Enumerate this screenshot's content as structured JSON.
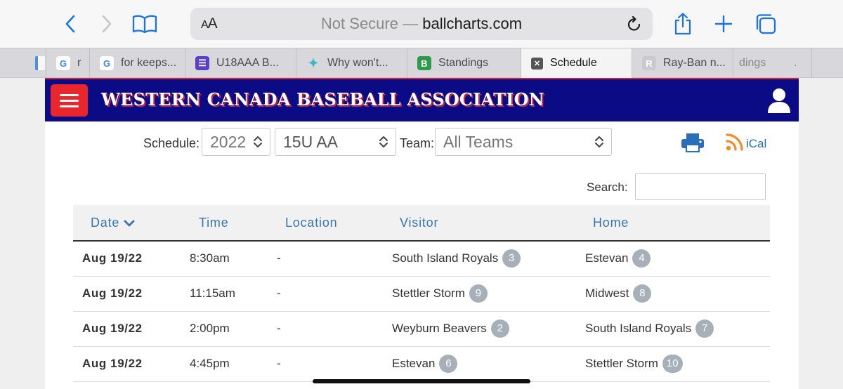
{
  "browser": {
    "address_aa": "AA",
    "not_secure": "Not Secure —",
    "domain": "ballcharts.com",
    "tabs": [
      {
        "label": "r",
        "favicon": "G",
        "fav_color": "#4285f4"
      },
      {
        "label": "for keeps...",
        "favicon": "G",
        "fav_color": "#4285f4"
      },
      {
        "label": "U18AAA B...",
        "favicon": "☰",
        "fav_color": "#5b3fc4"
      },
      {
        "label": "Why won't...",
        "favicon": "✦",
        "fav_color": "#3fb5c4"
      },
      {
        "label": "Standings",
        "favicon": "B",
        "fav_color": "#2e9a4b"
      },
      {
        "label": "Schedule",
        "favicon": "✕",
        "fav_color": "#555555"
      },
      {
        "label": "Ray-Ban n...",
        "favicon": "R",
        "fav_color": "#c9c9ce"
      },
      {
        "label": "dings",
        "favicon": "",
        "fav_color": ""
      },
      {
        "label": ".",
        "favicon": "",
        "fav_color": ""
      }
    ]
  },
  "site": {
    "title": "WESTERN CANADA BASEBALL ASSOCIATION"
  },
  "filters": {
    "schedule_label": "Schedule:",
    "year": "2022",
    "division": "15U AA",
    "team_label": "Team:",
    "team": "All Teams",
    "ical_label": "iCal",
    "search_label": "Search:",
    "search_value": ""
  },
  "table": {
    "headers": [
      "Date",
      "Time",
      "Location",
      "Visitor",
      "Home"
    ],
    "rows": [
      {
        "date": "Aug 19/22",
        "time": "8:30am",
        "location": "-",
        "visitor": "South Island Royals",
        "visitor_score": "3",
        "home": "Estevan",
        "home_score": "4"
      },
      {
        "date": "Aug 19/22",
        "time": "11:15am",
        "location": "-",
        "visitor": "Stettler Storm",
        "visitor_score": "9",
        "home": "Midwest",
        "home_score": "8"
      },
      {
        "date": "Aug 19/22",
        "time": "2:00pm",
        "location": "-",
        "visitor": "Weyburn Beavers",
        "visitor_score": "2",
        "home": "South Island Royals",
        "home_score": "7"
      },
      {
        "date": "Aug 19/22",
        "time": "4:45pm",
        "location": "-",
        "visitor": "Estevan",
        "visitor_score": "6",
        "home": "Stettler Storm",
        "home_score": "10"
      }
    ]
  },
  "colors": {
    "banner": "#0b0b86",
    "menu": "#e8262c",
    "header_text": "#3a74ad",
    "badge": "#a7b0b8",
    "accent": "#1a73e8"
  }
}
